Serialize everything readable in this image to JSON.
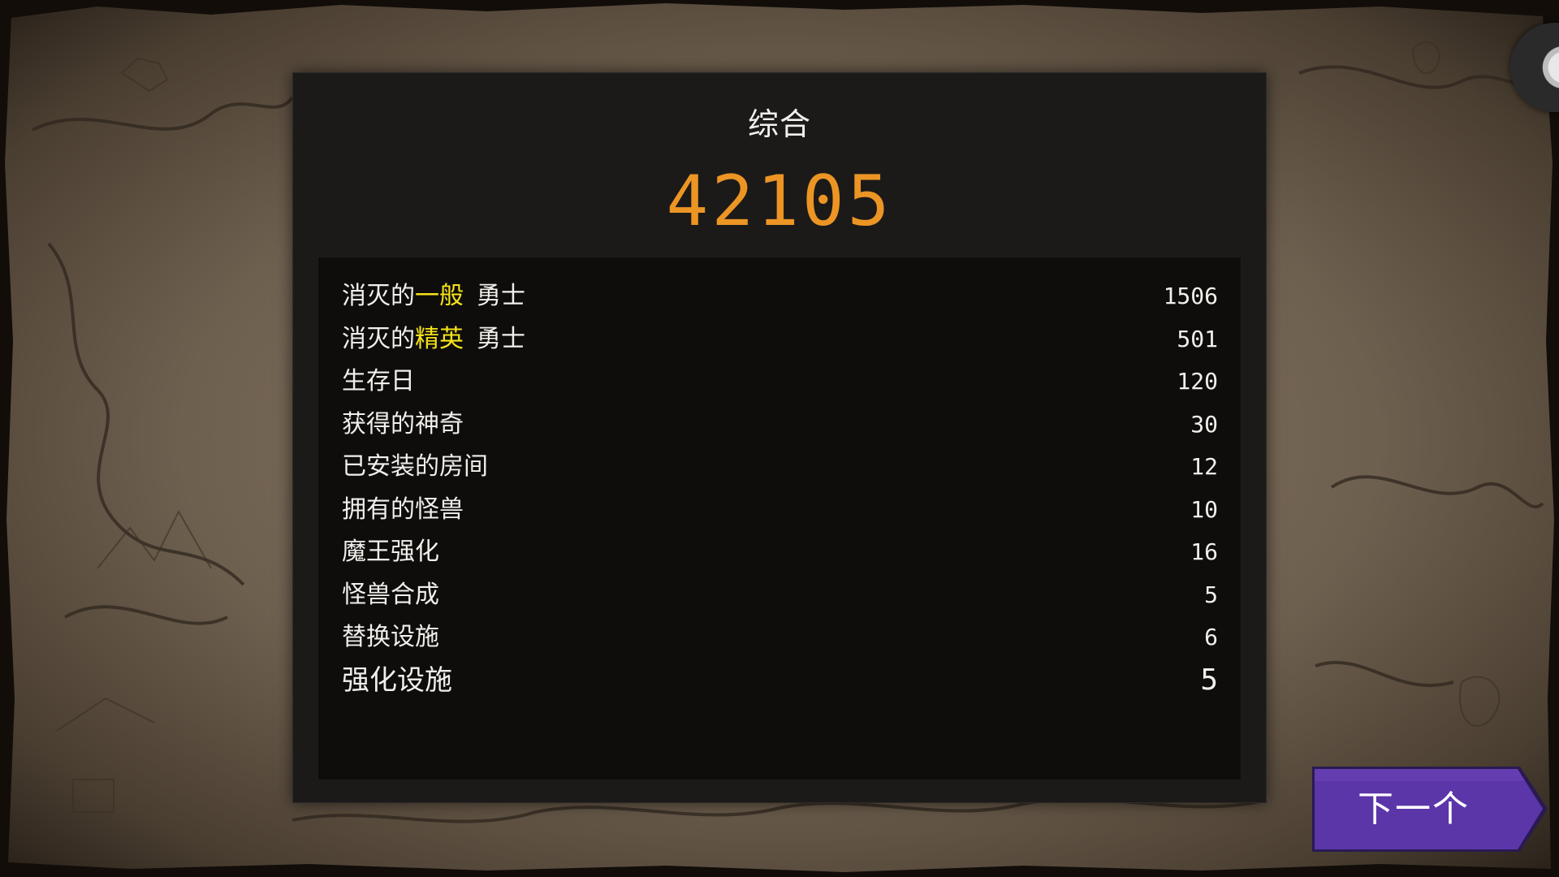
{
  "panel": {
    "title": "综合",
    "score": "42105"
  },
  "stats": [
    {
      "prefix": "消灭的",
      "highlight": "一般",
      "suffix": "勇士",
      "value": "1506"
    },
    {
      "prefix": "消灭的",
      "highlight": "精英",
      "suffix": "勇士",
      "value": "501"
    },
    {
      "prefix": "生存日",
      "highlight": "",
      "suffix": "",
      "value": "120"
    },
    {
      "prefix": "获得的神奇",
      "highlight": "",
      "suffix": "",
      "value": "30"
    },
    {
      "prefix": "已安装的房间",
      "highlight": "",
      "suffix": "",
      "value": "12"
    },
    {
      "prefix": "拥有的怪兽",
      "highlight": "",
      "suffix": "",
      "value": "10"
    },
    {
      "prefix": "魔王强化",
      "highlight": "",
      "suffix": "",
      "value": "16"
    },
    {
      "prefix": "怪兽合成",
      "highlight": "",
      "suffix": "",
      "value": "5"
    },
    {
      "prefix": "替换设施",
      "highlight": "",
      "suffix": "",
      "value": "6"
    },
    {
      "prefix": "强化设施",
      "highlight": "",
      "suffix": "",
      "value": "5"
    }
  ],
  "next_button": {
    "label": "下一个"
  },
  "colors": {
    "score": "#ec9524",
    "highlight": "#f6e21a",
    "button": "#5b36a8",
    "panel": "#1c1a19",
    "stats_box": "#0e0d0c"
  },
  "icons": {
    "background": "parchment-map",
    "corner": "round-orb-icon"
  }
}
